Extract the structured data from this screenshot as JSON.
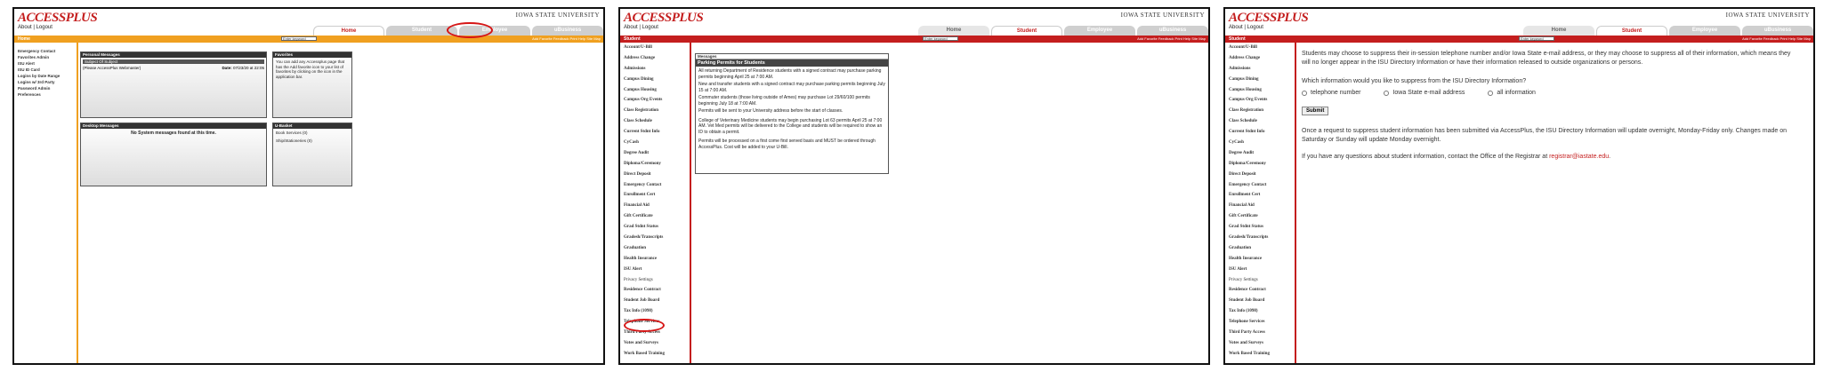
{
  "common": {
    "logo": "ACCESSPLUS",
    "about_logout": "About | Logout",
    "university": "IOWA STATE UNIVERSITY",
    "tabs": [
      "Home",
      "Student",
      "Employee",
      "uBusiness"
    ],
    "search_placeholder": "Enter keyword",
    "tools": "Add Favorite  Feedback  Print  Help  Site Map"
  },
  "panel1": {
    "bar_title": "Home",
    "sidebar": [
      "Emergency Contact",
      "Favorites Admin",
      "ISU Alert",
      "ISU ID Card",
      "Logins by Date Range",
      "Logins w/ 3rd Party",
      "Password Admin",
      "Preferences"
    ],
    "personal_messages": {
      "title": "Personal Messages",
      "row_subject": "Subject Of Subject",
      "row_from": "(Please AccessPlus Webmaster)",
      "row_date_label": "Date:",
      "row_date": "07/23/20 at 22:05"
    },
    "favorites": {
      "title": "Favorites",
      "text": "You can add any Accessplus page that has the Add favorite icon to your list of favorites by clicking on the icon in the application bar."
    },
    "desktop_messages": {
      "title": "Desktop Messages",
      "text": "No System messages found at this time."
    },
    "u_basket": {
      "title": "U-Basket",
      "lines": [
        "Book Services (0)",
        "Ship/Stationeries (0)"
      ]
    }
  },
  "panel2": {
    "bar_title": "Student",
    "sidebar": [
      "Account/U-Bill",
      "Address Change",
      "Admissions",
      "Campus Dining",
      "Campus Housing",
      "Campus Org Events",
      "Class Registration",
      "Class Schedule",
      "Current Stdnt Info",
      "CyCash",
      "Degree Audit",
      "Diploma/Ceremony",
      "Direct Deposit",
      "Emergency Contact",
      "Enrollment Cert",
      "Financial Aid",
      "Gift Certificate",
      "Grad Stdnt Status",
      "Gradesh/Transcripts",
      "Graduation",
      "Health Insurance",
      "ISU Alert",
      "Privacy Settings",
      "Residence Contract",
      "Student Job Board",
      "Tax Info (1098)",
      "Telephone Services",
      "Third Party Access",
      "Votes and Surveys",
      "Work Based Training"
    ],
    "messages": {
      "title": "Messages",
      "subtitle": "Parking Permits for Students",
      "paragraphs": [
        "All returning Department of Residence students with a signed contract may purchase parking permits beginning April 25 at 7:00 AM.",
        "New and transfer students with a signed contract may purchase parking permits beginning July 15 at 7:00 AM.",
        "Commuter students (those living outside of Ames) may purchase Lot 29/60/100 permits beginning July 18 at 7:00 AM.",
        "Permits will be sent to your University address before the start of classes.",
        "College of Veterinary Medicine students may begin purchasing Lot 63 permits April 25 at 7:00 AM. Vet Med permits will be delivered to the College and students will be required to show an ID to obtain a permit.",
        "Permits will be processed on a first come first served basis and MUST be ordered through AccessPlus. Cost will be added to your U-Bill."
      ]
    }
  },
  "panel3": {
    "bar_title": "Student",
    "sidebar": [
      "Account/U-Bill",
      "Address Change",
      "Admissions",
      "Campus Dining",
      "Campus Housing",
      "Campus Org Events",
      "Class Registration",
      "Class Schedule",
      "Current Stdnt Info",
      "CyCash",
      "Degree Audit",
      "Diploma/Ceremony",
      "Direct Deposit",
      "Emergency Contact",
      "Enrollment Cert",
      "Financial Aid",
      "Gift Certificate",
      "Grad Stdnt Status",
      "Gradesh/Transcripts",
      "Graduation",
      "Health Insurance",
      "ISU Alert",
      "Privacy Settings",
      "Residence Contract",
      "Student Job Board",
      "Tax Info (1098)",
      "Telephone Services",
      "Third Party Access",
      "Votes and Surveys",
      "Work Based Training"
    ],
    "intro": "Students may choose to suppress their in-session telephone number and/or Iowa State e-mail address, or they may choose to suppress all of their information, which means they will no longer appear in the ISU Directory Information or have their information released to outside organizations or persons.",
    "question": "Which information would you like to suppress from the ISU Directory Information?",
    "options": [
      "telephone number",
      "Iowa State e-mail address",
      "all information"
    ],
    "submit": "Submit",
    "note": "Once a request to suppress student information has been submitted via AccessPlus, the ISU Directory Information will update overnight, Monday-Friday only. Changes made on Saturday or Sunday will update Monday overnight.",
    "contact_prefix": "If you have any questions about student information, contact the Office of the Registrar at ",
    "contact_email": "registrar@iastate.edu",
    "contact_suffix": "."
  },
  "colors": {
    "accent": "#c41e1e",
    "home_bar": "#f0a020",
    "highlight_oval": "#d61515"
  }
}
